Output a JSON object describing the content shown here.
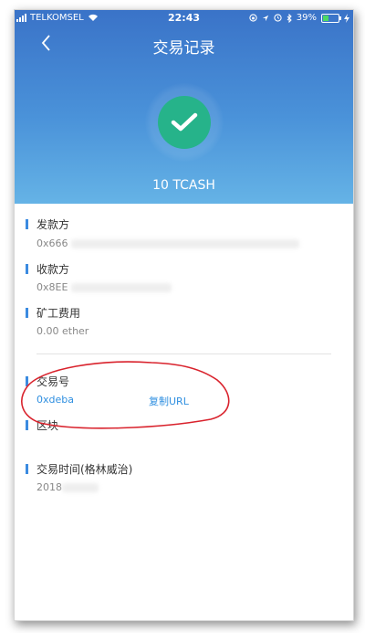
{
  "status_bar": {
    "carrier": "TELKOMSEL",
    "time": "22:43",
    "battery": "39%"
  },
  "header": {
    "back_icon": "chevron-left-icon",
    "title": "交易记录",
    "amount": "10 TCASH",
    "success_icon": "checkmark-icon",
    "colors": {
      "gradient_top": "#3a73c8",
      "gradient_bottom": "#65b3e6",
      "check_bg": "#26b38a"
    }
  },
  "details": {
    "sender": {
      "label": "发款方",
      "value": "0x666"
    },
    "receiver": {
      "label": "收款方",
      "value": "0x8EE"
    },
    "fee": {
      "label": "矿工费用",
      "value": "0.00 ether"
    },
    "tx_id": {
      "label": "交易号",
      "value": "0xdeba",
      "copy_label": "复制URL"
    },
    "block": {
      "label": "区块"
    },
    "tx_time": {
      "label": "交易时间(格林威治)",
      "value": "2018"
    }
  },
  "annotation": {
    "color": "#d9232d"
  }
}
